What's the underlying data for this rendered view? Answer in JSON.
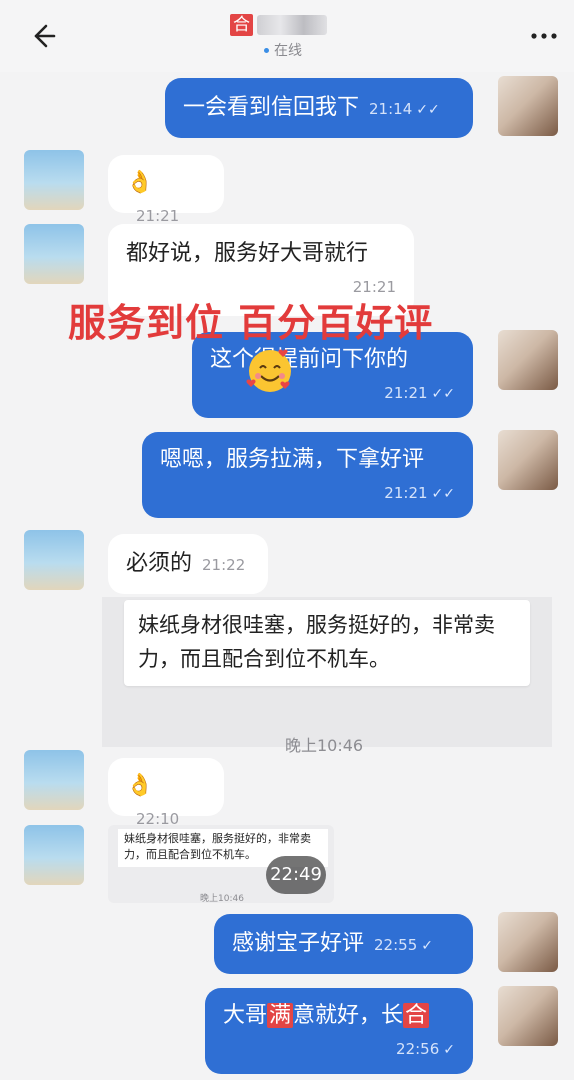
{
  "header": {
    "title_tag": "合",
    "status": "在线"
  },
  "overlay_text": "服务到位 百分百好评",
  "messages": [
    {
      "text": "一会看到信回我下",
      "time": "21:14"
    },
    {
      "text": "👌",
      "time": "21:21"
    },
    {
      "text": "都好说，服务好大哥就行",
      "time": "21:21"
    },
    {
      "text": "这个得提前问下你的",
      "time": "21:21"
    },
    {
      "text": "嗯嗯，服务拉满，下拿好评",
      "time": "21:21"
    },
    {
      "text": "必须的",
      "time": "21:22"
    },
    {
      "text": "👌",
      "time": "22:10"
    },
    {
      "text": "感谢宝子好评",
      "time": "22:55"
    },
    {
      "text_before": "大哥",
      "text_red": "满",
      "text_after": "意就好，长",
      "text_red2": "合",
      "time": "22:56"
    }
  ],
  "quote": {
    "text": "妹纸身材很哇塞，服务挺好的，非常卖力，而且配合到位不机车。",
    "time": "晚上10:46"
  },
  "small_quote": {
    "text": "妹纸身材很哇塞，服务挺好的，非常卖力，而且配合到位不机车。",
    "time": "晚上10:46",
    "video_time": "22:49"
  },
  "icons": {
    "back": "back-arrow-icon",
    "more": "more-icon",
    "read": "read-receipt-icon",
    "sent": "sent-check-icon"
  }
}
